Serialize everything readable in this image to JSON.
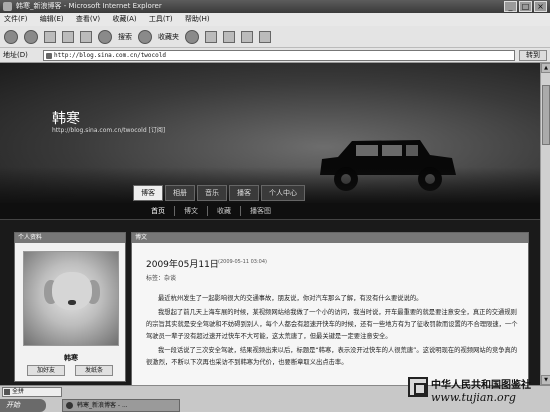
{
  "window": {
    "title": "韩寒_新浪博客 - Microsoft Internet Explorer",
    "controls": [
      "_",
      "□",
      "×"
    ]
  },
  "menu": [
    "文件(F)",
    "编辑(E)",
    "查看(V)",
    "收藏(A)",
    "工具(T)",
    "帮助(H)"
  ],
  "toolbar": {
    "search_label": "搜索",
    "favorites_label": "收藏夹"
  },
  "address": {
    "label": "地址(D)",
    "url": "http://blog.sina.com.cn/twocold",
    "go_label": "转到"
  },
  "blog": {
    "title": "韩寒",
    "url_line": "http://blog.sina.com.cn/twocold [订阅]",
    "tabs": [
      "博客",
      "相册",
      "音乐",
      "播客",
      "个人中心"
    ],
    "subnav": [
      "首页",
      "博文",
      "收藏",
      "播客图"
    ]
  },
  "sidebar": {
    "heading": "个人资料",
    "name": "韩寒",
    "buttons": [
      "加好友",
      "发纸条"
    ]
  },
  "post": {
    "heading": "博文",
    "date": "2009年05月11日",
    "time": "(2009-05-11 03:04)",
    "tag": "标签：杂谈",
    "paragraphs": [
      "最近杭州发生了一起影响很大的交通事故，朋友说，你对汽车那么了解，有没有什么要说说的。",
      "我想起了前几天上海车展的时候，某视频网站给我做了一个小的访问，我当时说，开车最重要的就是要注意安全，真正的交通规则的宗旨其实就是安全驾驶和不妨碍到别人，每个人都会有超速开快车的时候，还有一些地方有为了征收罚款而设置的不合理限速，一个驾驶员一辈子没有超过速开过快车不大可能，这太荒唐了，但最关键是一定要注意安全。",
      "我一段话说了三次安全驾驶，结果视频出来以后，标题是“韩寒，表示没开过快车的人很荒唐”。这说明现在的视频网站的竞争真的很激烈，不断以下次再也采访不到韩寒为代价，也要断章取义出点击率。"
    ]
  },
  "taskbar": {
    "ime": "全拼",
    "start": "开始",
    "task": "韩寒_新浪博客 - ..."
  },
  "watermark": {
    "org": "中华人民共和国图鉴社",
    "url": "www.tujian.org"
  }
}
